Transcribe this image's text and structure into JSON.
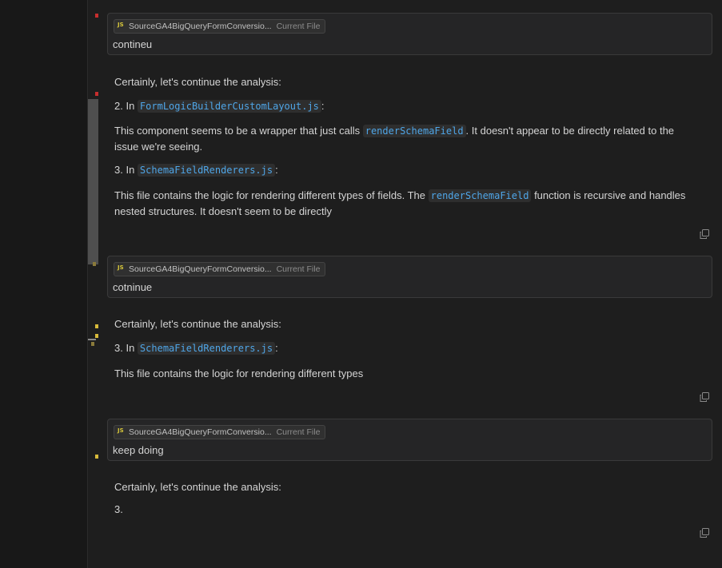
{
  "conversation": [
    {
      "user": {
        "file_name": "SourceGA4BigQueryFormConversio...",
        "file_tag": "Current File",
        "message": "contineu"
      },
      "assistant": {
        "intro": "Certainly, let's continue the analysis:",
        "item2_prefix": "2. In ",
        "item2_file": "FormLogicBuilderCustomLayout.js",
        "item2_suffix": ":",
        "p1_before": "This component seems to be a wrapper that just calls ",
        "p1_code": "renderSchemaField",
        "p1_after": ". It doesn't appear to be directly related to the issue we're seeing.",
        "item3_prefix": "3. In ",
        "item3_file": "SchemaFieldRenderers.js",
        "item3_suffix": ":",
        "p2_before": "This file contains the logic for rendering different types of fields. The ",
        "p2_code": "renderSchemaField",
        "p2_after": " function is recursive and handles nested structures. It doesn't seem to be directly"
      }
    },
    {
      "user": {
        "file_name": "SourceGA4BigQueryFormConversio...",
        "file_tag": "Current File",
        "message": "cotninue"
      },
      "assistant": {
        "intro": "Certainly, let's continue the analysis:",
        "item3_prefix": "3. In ",
        "item3_file": "SchemaFieldRenderers.js",
        "item3_suffix": ":",
        "p1": "This file contains the logic for rendering different types"
      }
    },
    {
      "user": {
        "file_name": "SourceGA4BigQueryFormConversio...",
        "file_tag": "Current File",
        "message": "keep doing"
      },
      "assistant": {
        "intro": "Certainly, let's continue the analysis:",
        "item": "3."
      }
    }
  ],
  "icons": {
    "file_type": "js-icon",
    "copy": "copy-icon"
  },
  "colors": {
    "code_text": "#4fa6e8",
    "js_icon": "#d7c73a",
    "error_mark": "#c72e2e",
    "warning_mark": "#d7ba3a"
  }
}
